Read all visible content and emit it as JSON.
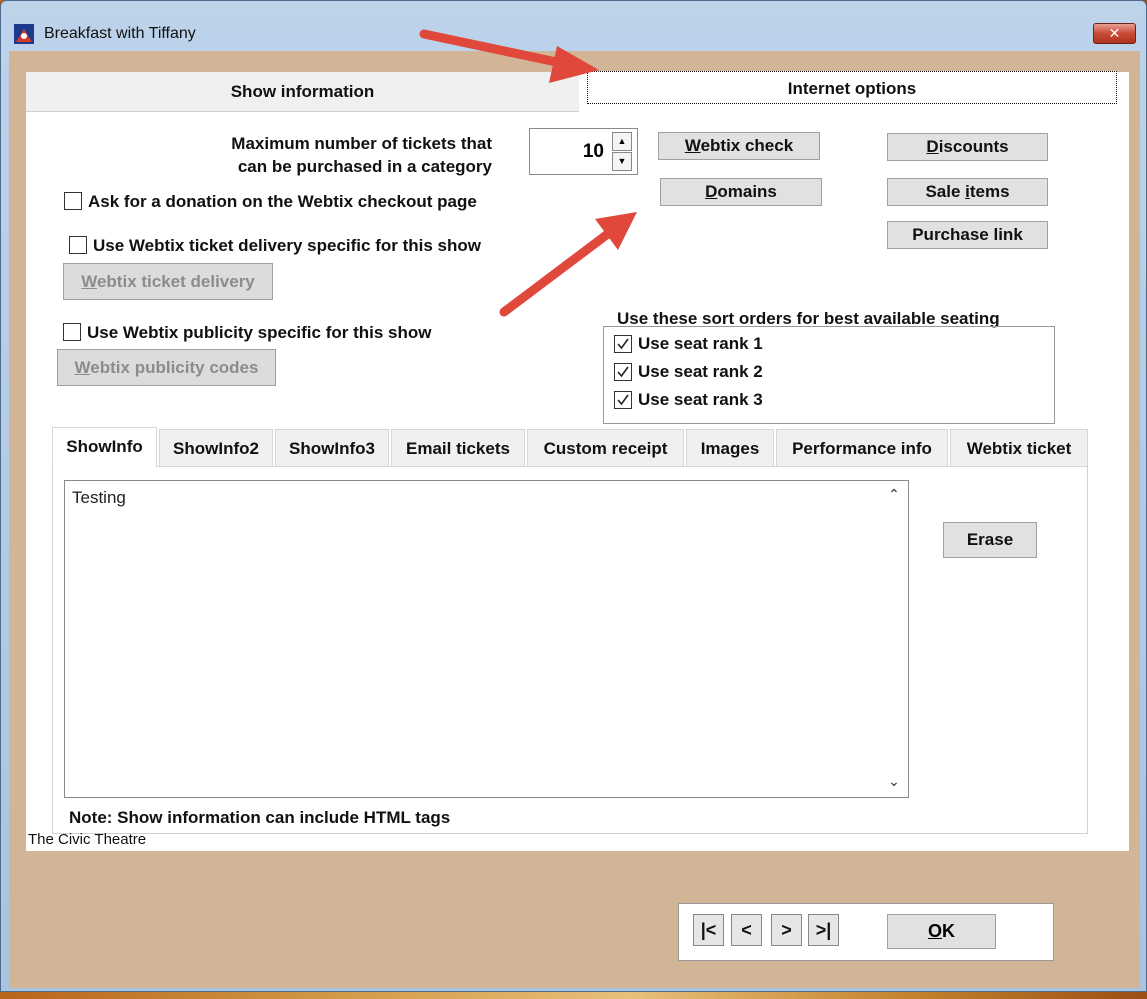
{
  "window": {
    "title": "Breakfast with Tiffany",
    "close_label": "✕"
  },
  "main_tabs": [
    {
      "label": "Show information",
      "active": false
    },
    {
      "label": "Internet options",
      "active": true
    }
  ],
  "max_tickets": {
    "label_line1": "Maximum number of tickets that",
    "label_line2": "can be purchased in a category",
    "value": "10"
  },
  "buttons": {
    "webtix_check": {
      "pre": "",
      "u": "W",
      "post": "ebtix check"
    },
    "domains": {
      "pre": "",
      "u": "D",
      "post": "omains"
    },
    "discounts": {
      "pre": "",
      "u": "D",
      "post": "iscounts"
    },
    "sale_items": {
      "pre": "Sale ",
      "u": "i",
      "post": "tems"
    },
    "purchase_link": "Purchase link",
    "webtix_ticket_delivery": {
      "pre": "",
      "u": "W",
      "post": "ebtix ticket delivery"
    },
    "webtix_publicity_codes": {
      "pre": "",
      "u": "W",
      "post": "ebtix publicity codes"
    },
    "erase": "Erase",
    "ok": {
      "pre": "",
      "u": "O",
      "post": "K"
    }
  },
  "checkboxes": {
    "donation": {
      "label": "Ask for a donation on the Webtix checkout page",
      "checked": false
    },
    "ticket_delivery": {
      "label": "Use Webtix ticket delivery specific for this show",
      "checked": false
    },
    "publicity": {
      "label": "Use Webtix publicity specific for this show",
      "checked": false
    }
  },
  "seating": {
    "heading": "Use these sort orders for best available seating",
    "ranks": [
      {
        "label": "Use seat rank 1",
        "checked": true
      },
      {
        "label": "Use seat rank 2",
        "checked": true
      },
      {
        "label": "Use seat rank 3",
        "checked": true
      }
    ]
  },
  "sub_tabs": [
    {
      "label": "ShowInfo",
      "active": true
    },
    {
      "label": "ShowInfo2",
      "active": false
    },
    {
      "label": "ShowInfo3",
      "active": false
    },
    {
      "label": "Email tickets",
      "active": false
    },
    {
      "label": "Custom receipt",
      "active": false
    },
    {
      "label": "Images",
      "active": false
    },
    {
      "label": "Performance info",
      "active": false
    },
    {
      "label": "Webtix ticket",
      "active": false
    }
  ],
  "show_info_text": "Testing",
  "note": "Note: Show information can include HTML tags",
  "footer_label": "The Civic Theatre",
  "nav": {
    "first": "|<",
    "prev": "<",
    "next": ">",
    "last": ">|"
  },
  "colors": {
    "annotation_arrow": "#e0483c",
    "dialog_bg": "#d2b596"
  }
}
